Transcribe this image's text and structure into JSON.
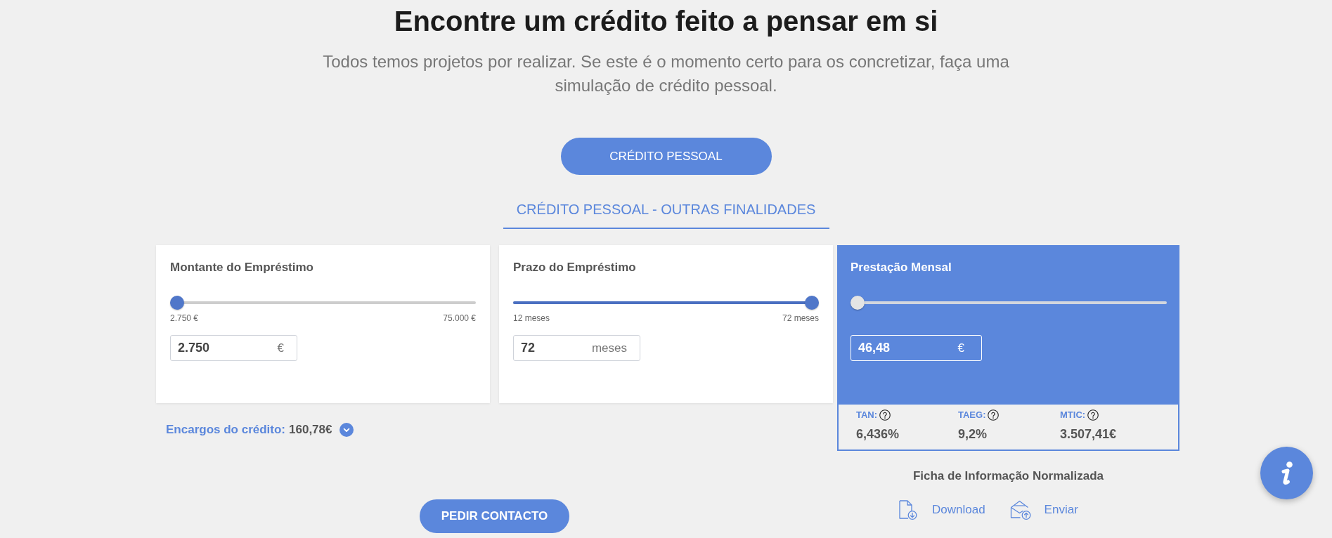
{
  "header": {
    "title": "Encontre um crédito feito a pensar em si",
    "subtitle": "Todos temos projetos por realizar. Se este é o momento certo para os concretizar, faça uma simulação de crédito pessoal."
  },
  "product_button": {
    "label": "CRÉDITO PESSOAL"
  },
  "tabs": [
    {
      "label": "CRÉDITO PESSOAL - OUTRAS FINALIDADES",
      "selected": true
    }
  ],
  "cards": [
    {
      "kind": "input",
      "title": "Montante do Empréstimo",
      "level": 0,
      "min_label": "2.750 €",
      "max_label": "75.000 €",
      "value": "2.750",
      "unit": "€"
    },
    {
      "kind": "input",
      "title": "Prazo do Empréstimo",
      "level": 1,
      "min_label": "12 meses",
      "max_label": "72 meses",
      "value": "72",
      "unit": "meses"
    },
    {
      "kind": "result",
      "title": "Prestação Mensal",
      "level": 0,
      "value": "46,48",
      "unit": "€",
      "rates": [
        {
          "label": "TAN:",
          "value": "6,436%"
        },
        {
          "label": "TAEG:",
          "value": "9,2%"
        },
        {
          "label": "MTIC:",
          "value": "3.507,41€"
        }
      ]
    }
  ],
  "charges": {
    "label": "Encargos do crédito:",
    "value": "160,78€"
  },
  "contact_button": {
    "label": "PEDIR CONTACTO"
  },
  "info_sheet": {
    "title": "Ficha de Informação Normalizada",
    "actions": [
      {
        "kind": "download",
        "label": "Download"
      },
      {
        "kind": "send",
        "label": "Enviar"
      }
    ]
  }
}
